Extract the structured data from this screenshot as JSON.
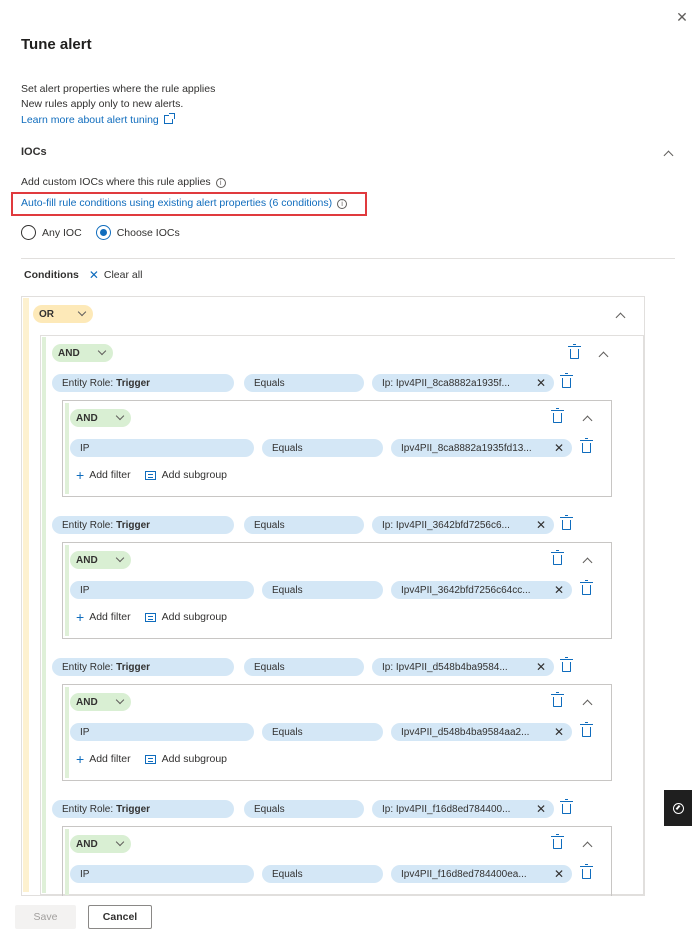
{
  "panel": {
    "title": "Tune alert",
    "close_icon": "close-icon",
    "description_line1": "Set alert properties where the rule applies",
    "description_line2": "New rules apply only to new alerts.",
    "learn_more_link": "Learn more about alert tuning"
  },
  "iocs": {
    "section_title": "IOCs",
    "custom_iocs_text": "Add custom IOCs where this rule applies",
    "autofill_link": "Auto-fill rule conditions using existing alert properties (6 conditions)",
    "radio_any": "Any IOC",
    "radio_choose": "Choose IOCs",
    "selected": "Choose IOCs"
  },
  "conditions": {
    "label": "Conditions",
    "clear_all": "Clear all",
    "or_operator": "OR",
    "and_operator": "AND",
    "add_filter": "Add filter",
    "add_subgroup": "Add subgroup",
    "groups": [
      {
        "entity_label": "Entity Role:",
        "entity_value": "Trigger",
        "operator": "Equals",
        "value": "Ip: Ipv4PII_8ca8882a1935f...",
        "sub_field": "IP",
        "sub_operator": "Equals",
        "sub_value": "Ipv4PII_8ca8882a1935fd13..."
      },
      {
        "entity_label": "Entity Role:",
        "entity_value": "Trigger",
        "operator": "Equals",
        "value": "Ip: Ipv4PII_3642bfd7256c6...",
        "sub_field": "IP",
        "sub_operator": "Equals",
        "sub_value": "Ipv4PII_3642bfd7256c64cc..."
      },
      {
        "entity_label": "Entity Role:",
        "entity_value": "Trigger",
        "operator": "Equals",
        "value": "Ip: Ipv4PII_d548b4ba9584...",
        "sub_field": "IP",
        "sub_operator": "Equals",
        "sub_value": "Ipv4PII_d548b4ba9584aa2..."
      },
      {
        "entity_label": "Entity Role:",
        "entity_value": "Trigger",
        "operator": "Equals",
        "value": "Ip: Ipv4PII_f16d8ed784400...",
        "sub_field": "IP",
        "sub_operator": "Equals",
        "sub_value": "Ipv4PII_f16d8ed784400ea..."
      }
    ]
  },
  "footer": {
    "save_label": "Save",
    "cancel_label": "Cancel"
  },
  "colors": {
    "link": "#0f6cbd",
    "or_pill": "#fde9b8",
    "and_pill": "#d9efd3",
    "field_pill": "#d4e7f6",
    "highlight_border": "#e03a3e"
  }
}
